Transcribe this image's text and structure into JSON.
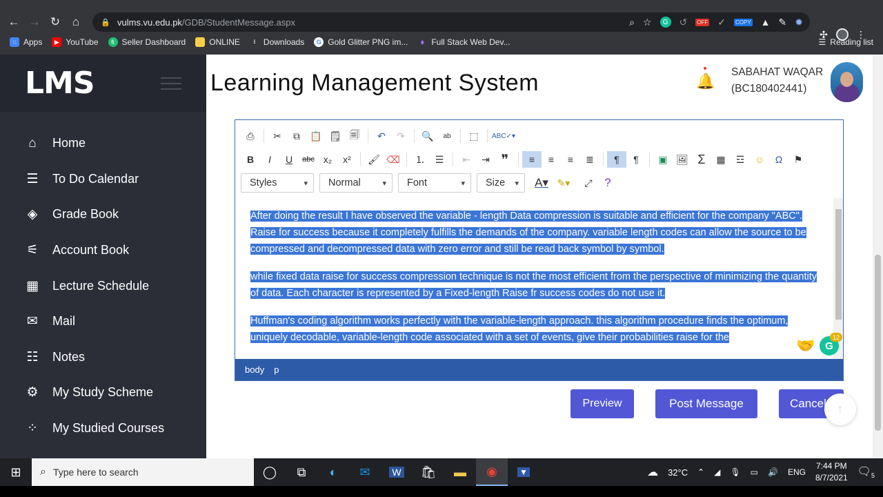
{
  "browser": {
    "url_host": "vulms.vu.edu.pk",
    "url_path": "/GDB/StudentMessage.aspx",
    "bookmarks": [
      {
        "label": "Apps",
        "color": "#4285f4",
        "icon": "apps-grid-icon"
      },
      {
        "label": "YouTube",
        "color": "#ff0000",
        "icon": "youtube-icon"
      },
      {
        "label": "Seller Dashboard",
        "color": "#1dbf73",
        "icon": "fiverr-icon"
      },
      {
        "label": "ONLINE",
        "color": "#f9cf4a",
        "icon": "folder-icon"
      },
      {
        "label": "Downloads",
        "color": "#e8eaed",
        "icon": "download-icon"
      },
      {
        "label": "Gold Glitter PNG im...",
        "color": "#ffffff",
        "icon": "google-icon"
      },
      {
        "label": "Full Stack Web Dev...",
        "color": "#7b3fe4",
        "icon": "bulb-icon"
      }
    ],
    "reading_list": "Reading list",
    "ext_off_badge": "OFF",
    "ext_copy_badge": "COPY"
  },
  "sidebar": {
    "logo": "LMS",
    "items": [
      {
        "label": "Home",
        "icon": "home-icon",
        "glyph": "⌂"
      },
      {
        "label": "To Do Calendar",
        "icon": "list-icon",
        "glyph": "☰"
      },
      {
        "label": "Grade Book",
        "icon": "layers-icon",
        "glyph": "◈"
      },
      {
        "label": "Account Book",
        "icon": "sliders-icon",
        "glyph": "⚟"
      },
      {
        "label": "Lecture Schedule",
        "icon": "calendar-icon",
        "glyph": "▦"
      },
      {
        "label": "Mail",
        "icon": "mail-icon",
        "glyph": "✉"
      },
      {
        "label": "Notes",
        "icon": "checklist-icon",
        "glyph": "☷"
      },
      {
        "label": "My Study Scheme",
        "icon": "gear-icon",
        "glyph": "⚙"
      },
      {
        "label": "My Studied Courses",
        "icon": "grid-dots-icon",
        "glyph": "⁘"
      }
    ]
  },
  "header": {
    "title": "Learning Management System",
    "user_name": "SABAHAT WAQAR",
    "user_id": "(BC180402441)"
  },
  "editor": {
    "toolbar_combos": {
      "styles": "Styles",
      "format": "Normal",
      "font": "Font",
      "size": "Size"
    },
    "paragraphs": [
      "After doing the result I have observed the variable - length Data compression is suitable and efficient for the company \"ABC\". Raise for success because it completely fulfills the demands of the company. variable length codes can allow the source to be compressed and decompressed data with zero error and still be read back symbol by symbol.",
      "while fixed data raise for success compression technique is not the most efficient from the perspective of minimizing the quantity of data. Each character is represented by a Fixed-length Raise fr success codes do not use it.",
      "Huffman's coding algorithm works perfectly with the variable-length approach. this algorithm procedure finds the optimum, uniquely decodable, variable-length code associated with a set of events, give their probabilities raise for the"
    ],
    "path_body": "body",
    "path_p": "p",
    "grammarly_count": "12"
  },
  "actions": {
    "preview": "Preview",
    "post": "Post Message",
    "cancel": "Cancel"
  },
  "taskbar": {
    "search_placeholder": "Type here to search",
    "temperature": "32°C",
    "language": "ENG",
    "time": "7:44 PM",
    "date": "8/7/2021",
    "notifications": "5"
  }
}
